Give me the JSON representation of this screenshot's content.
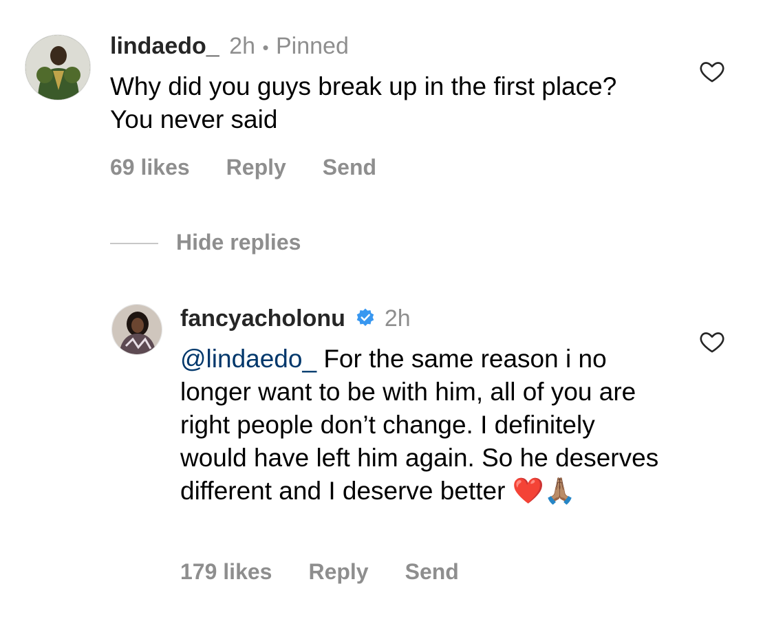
{
  "comments": [
    {
      "username": "lindaedo_",
      "time": "2h",
      "separator": "•",
      "pinned_label": "Pinned",
      "text": "Why did you guys break up in the first place? You never said",
      "likes": "69 likes",
      "reply_label": "Reply",
      "send_label": "Send",
      "icon": "heart-outline-icon"
    }
  ],
  "hide_replies_label": "Hide replies",
  "reply": {
    "username": "fancyacholonu",
    "verified": true,
    "time": "2h",
    "mention": "@lindaedo_",
    "text": " For the same reason i no longer want to be with him, all of you are right people don’t change. I definitely would have left him again. So he deserves different and I deserve better ",
    "emojis": [
      "❤️",
      "🙏🏽"
    ],
    "likes": "179 likes",
    "reply_label": "Reply",
    "send_label": "Send",
    "icon": "heart-outline-icon"
  },
  "colors": {
    "verified": "#3897f0",
    "mention": "#00376b",
    "muted": "#8e8e8e"
  }
}
